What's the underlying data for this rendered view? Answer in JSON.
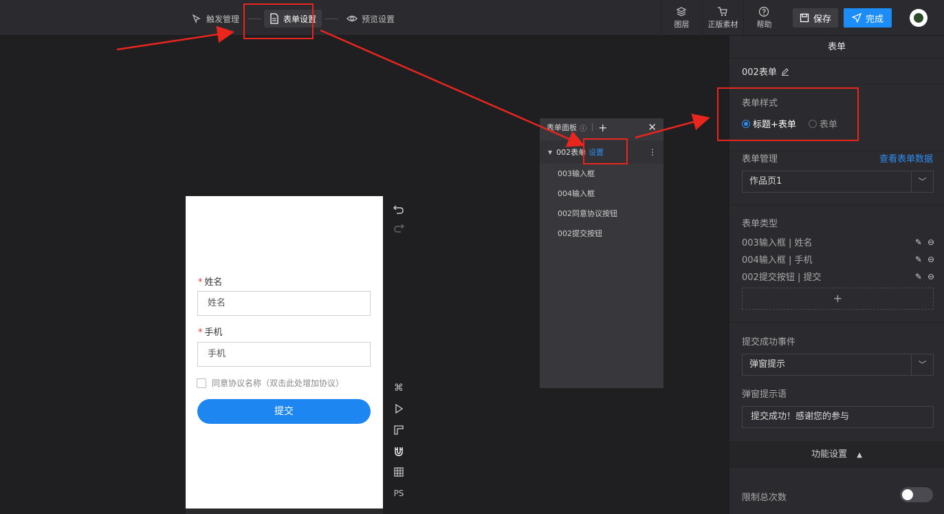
{
  "topbar": {
    "steps": [
      {
        "label": "触发管理",
        "icon": "trigger-icon"
      },
      {
        "label": "表单设置",
        "icon": "document-icon"
      },
      {
        "label": "预览设置",
        "icon": "eye-icon"
      }
    ],
    "tools": [
      {
        "label": "图层",
        "icon": "layers-icon"
      },
      {
        "label": "正版素材",
        "icon": "cart-icon"
      },
      {
        "label": "帮助",
        "icon": "help-icon"
      }
    ],
    "save_label": "保存",
    "done_label": "完成"
  },
  "form_preview": {
    "name_label": "姓名",
    "name_placeholder": "姓名",
    "phone_label": "手机",
    "phone_placeholder": "手机",
    "agree_text": "同意协议名称（双击此处增加协议）",
    "submit_label": "提交"
  },
  "layers_panel": {
    "title": "表单面板",
    "group_name": "002表单",
    "group_action": "设置",
    "items": [
      "003输入框",
      "004输入框",
      "002同意协议按钮",
      "002提交按钮"
    ]
  },
  "right_panel": {
    "title": "表单",
    "form_name": "002表单",
    "style_label": "表单样式",
    "style_options": [
      "标题+表单",
      "表单"
    ],
    "manage_label": "表单管理",
    "manage_link": "查看表单数据",
    "manage_select": "作品页1",
    "type_label": "表单类型",
    "types": [
      "003输入框 | 姓名",
      "004输入框 | 手机",
      "002提交按钮 | 提交"
    ],
    "add_symbol": "+",
    "success_event_label": "提交成功事件",
    "success_event_select": "弹窗提示",
    "popup_label": "弹窗提示语",
    "popup_text": "提交成功！感谢您的参与",
    "function_settings": "功能设置",
    "limit_total_label": "限制总次数"
  },
  "colors": {
    "accent": "#1c8df7",
    "annotation": "#e8261d"
  }
}
